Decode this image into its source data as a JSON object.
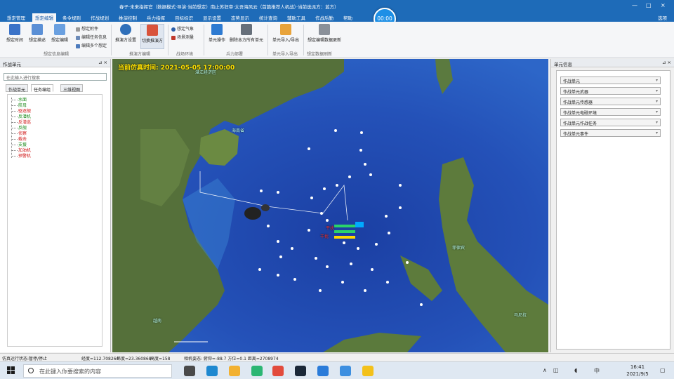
{
  "window": {
    "title": "春子·未来指挥官（数据模式·导演·当前想定）南止苏狂审·太吾海风云（首篇推荐人机战）·当前选派方：蓝方）",
    "minimize": "—",
    "maximize": "□",
    "close": "×"
  },
  "menu": {
    "items": [
      "想定管理",
      "想定编辑",
      "条令规则",
      "作战规划",
      "推演控制",
      "兵力指挥",
      "目标标识",
      "显示设置",
      "态势显示",
      "统计查询",
      "辅助工具",
      "作战后勤",
      "帮助"
    ],
    "active": "想定编辑",
    "right_label": "选项"
  },
  "clock_badge": "00:00",
  "ribbon": {
    "buttons": [
      {
        "label": "想定时间",
        "color": "#3b73c8"
      },
      {
        "label": "想定描述",
        "color": "#5a8fd6"
      },
      {
        "label": "想定编辑",
        "color": "#6aa0e0"
      },
      {
        "label": "推演方设置",
        "color": "#2f6fb9"
      },
      {
        "label": "切换推演方",
        "color": "#d9533b"
      },
      {
        "label": "单元操作",
        "color": "#2d7ad1"
      },
      {
        "label": "删除本方所有单元",
        "color": "#666f7a"
      },
      {
        "label": "单元导入/导出",
        "color": "#e8a33a"
      },
      {
        "label": "想定编辑数据更新",
        "color": "#8a9099"
      }
    ],
    "small": {
      "event": "想定附件",
      "task_edit": "编辑任务信息",
      "weather": "想定气象",
      "battle_damage": "场景测量",
      "editor": "编辑多个想定"
    },
    "groups": [
      "想定信息编辑",
      "推演方编辑",
      "战场环境",
      "兵力部署",
      "单元导入导出",
      "想定数据刷新"
    ]
  },
  "left_panel": {
    "title": "作战单元",
    "search_placeholder": "在此输入进行搜索",
    "tabs": [
      "作战单元",
      "任务编组",
      "三维视图"
    ],
    "active_tab": "任务编组",
    "tree": [
      {
        "label": "水面",
        "color": "#1a8a1a"
      },
      {
        "label": "航母",
        "color": "#1a8a1a"
      },
      {
        "label": "驱逐舰",
        "color": "#d01818"
      },
      {
        "label": "反潜机",
        "color": "#1a8a1a"
      },
      {
        "label": "反潜巡",
        "color": "#d01818"
      },
      {
        "label": "反舰",
        "color": "#1a8a1a"
      },
      {
        "label": "侦察",
        "color": "#d01818"
      },
      {
        "label": "截击",
        "color": "#d01818"
      },
      {
        "label": "支援",
        "color": "#1a8a1a"
      },
      {
        "label": "加油机",
        "color": "#d01818"
      },
      {
        "label": "预警机",
        "color": "#d01818"
      }
    ]
  },
  "map": {
    "sim_time": "当前仿真时间:  2021-05-05 17:00:00",
    "places": [
      "湛江经济区",
      "海南省",
      "越南",
      "菲律宾",
      "马尼拉"
    ],
    "unit_labels": [
      "干扰",
      "干扰"
    ]
  },
  "right_panel": {
    "title": "单元信息",
    "fields": [
      "作战单元",
      "作战单元武器",
      "作战单元传感器",
      "作战单元电磁环境",
      "作战单元作战任务",
      "作战单元事件"
    ]
  },
  "statusbar": {
    "left": "仿真运行状态:暂停/停止",
    "lon": "经度=112.708264",
    "lat": "纬度=23.360868",
    "alt": "高度=158",
    "view": "相机姿态: 俯仰=-88.7  方位=0.1  距离=2708974"
  },
  "taskbar": {
    "search_placeholder": "在此键入你要搜索的内容",
    "time": "16:41",
    "date": "2021/9/5",
    "ime": "中",
    "apps": [
      {
        "name": "task-view",
        "color": "#4a4a4a"
      },
      {
        "name": "edge",
        "color": "#1e88d0"
      },
      {
        "name": "files",
        "color": "#f2b132"
      },
      {
        "name": "media",
        "color": "#2bb673"
      },
      {
        "name": "chrome",
        "color": "#e24b3c"
      },
      {
        "name": "steam",
        "color": "#1b2838"
      },
      {
        "name": "app-g",
        "color": "#2a7bd9"
      },
      {
        "name": "app-blue",
        "color": "#3d8fe0"
      },
      {
        "name": "app-yellow",
        "color": "#f3c11b"
      }
    ]
  }
}
